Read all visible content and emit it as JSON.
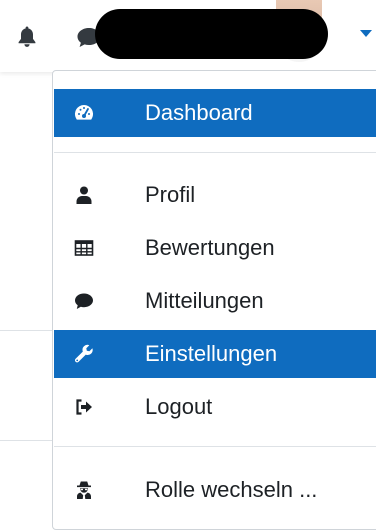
{
  "navbar": {
    "icons": [
      "bell-icon",
      "chat-icon"
    ],
    "accent_color": "#0f6cbf"
  },
  "menu": {
    "items": [
      {
        "label": "Dashboard",
        "icon": "dashboard-icon",
        "active": true
      },
      {
        "label": "Profil",
        "icon": "user-icon",
        "active": false
      },
      {
        "label": "Bewertungen",
        "icon": "table-icon",
        "active": false
      },
      {
        "label": "Mitteilungen",
        "icon": "comment-icon",
        "active": false
      },
      {
        "label": "Einstellungen",
        "icon": "wrench-icon",
        "active": true
      },
      {
        "label": "Logout",
        "icon": "sign-out-icon",
        "active": false
      },
      {
        "label": "Rolle wechseln ...",
        "icon": "user-secret-icon",
        "active": false
      }
    ]
  },
  "colors": {
    "active_bg": "#0f6cbf",
    "active_text": "#ffffff",
    "text": "#1d2125",
    "divider": "#dee2e6"
  }
}
